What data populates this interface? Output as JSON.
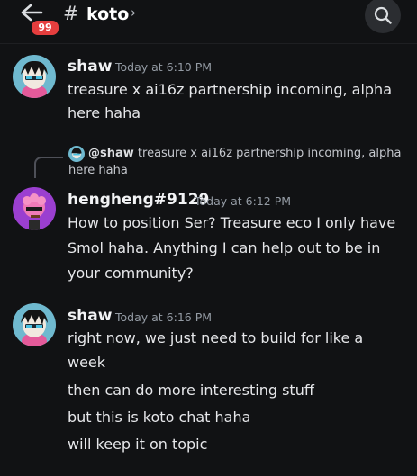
{
  "header": {
    "unread_count": "99",
    "hash": "#",
    "channel_name": "koto",
    "chevron": "›",
    "back_icon": "arrow-left-icon",
    "search_icon": "search-icon"
  },
  "messages": [
    {
      "author": "shaw",
      "timestamp": "Today at 6:10 PM",
      "lines": [
        "treasure x ai16z partnership incoming, alpha",
        "here haha"
      ]
    },
    {
      "reply": {
        "mention": "@shaw",
        "line1": "treasure x ai16z partnership incoming, alpha",
        "line2": "here haha"
      },
      "author": "hengheng#9129",
      "timestamp": "Today at 6:12 PM",
      "lines": [
        "How to position Ser? Treasure eco I only have",
        "Smol haha. Anything I can help out to be in",
        "your community?"
      ]
    },
    {
      "author": "shaw",
      "timestamp": "Today at 6:16 PM",
      "lines": [
        "right now, we just need to build for like a",
        "week",
        "then can do more interesting stuff",
        "but this is koto chat haha",
        "will keep it on topic"
      ]
    }
  ],
  "colors": {
    "background": "#111214",
    "badge": "#e53e3e",
    "muted": "#949ba4"
  }
}
